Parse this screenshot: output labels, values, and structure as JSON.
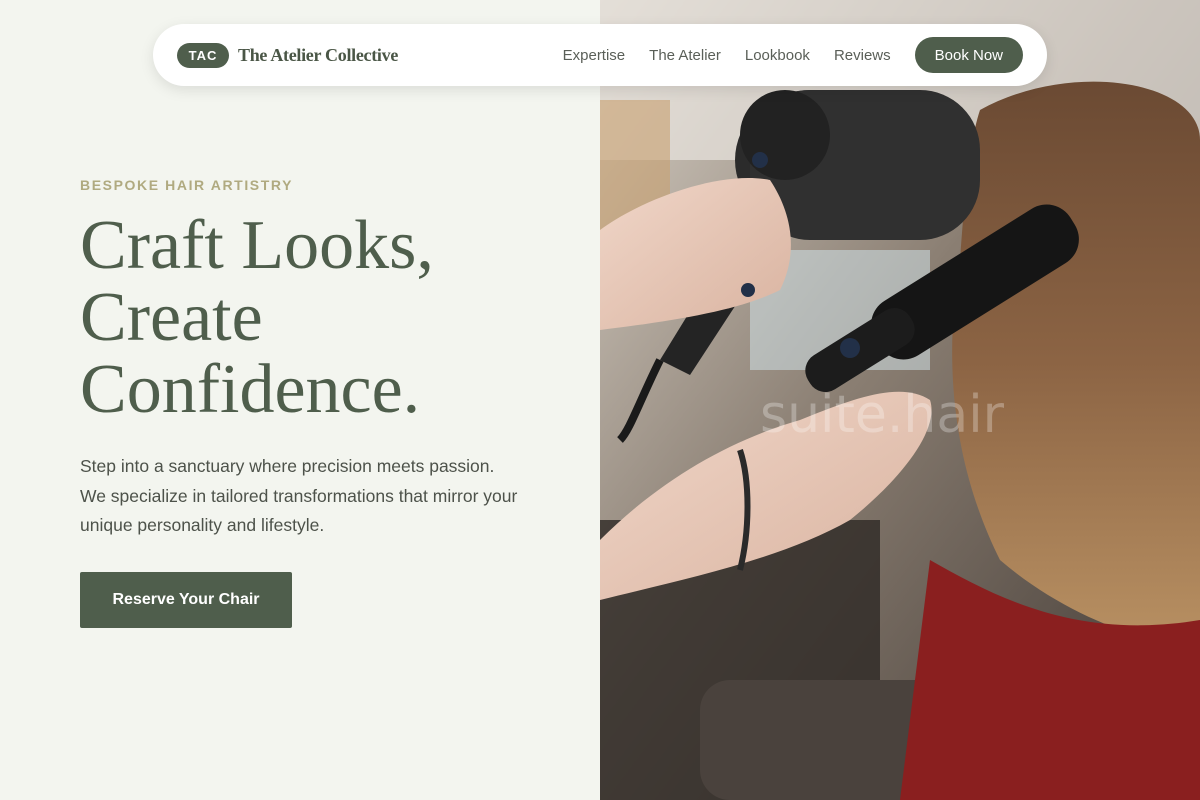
{
  "nav": {
    "badge": "TAC",
    "brand_name": "The Atelier Collective",
    "links": [
      "Expertise",
      "The Atelier",
      "Lookbook",
      "Reviews"
    ],
    "cta": "Book Now"
  },
  "hero": {
    "eyebrow": "BESPOKE HAIR ARTISTRY",
    "headline": [
      "Craft Looks,",
      "Create",
      "Confidence."
    ],
    "description": "Step into a sanctuary where precision meets passion. We specialize in tailored transformations that mirror your unique personality and lifestyle.",
    "cta": "Reserve Your Chair"
  },
  "photo": {
    "watermark": "suite.hair",
    "subject": "stylist blow-drying client's hair with round brush"
  },
  "colors": {
    "accent": "#4f5e4c",
    "background": "#f3f5ef",
    "eyebrow": "#b0aa80"
  }
}
